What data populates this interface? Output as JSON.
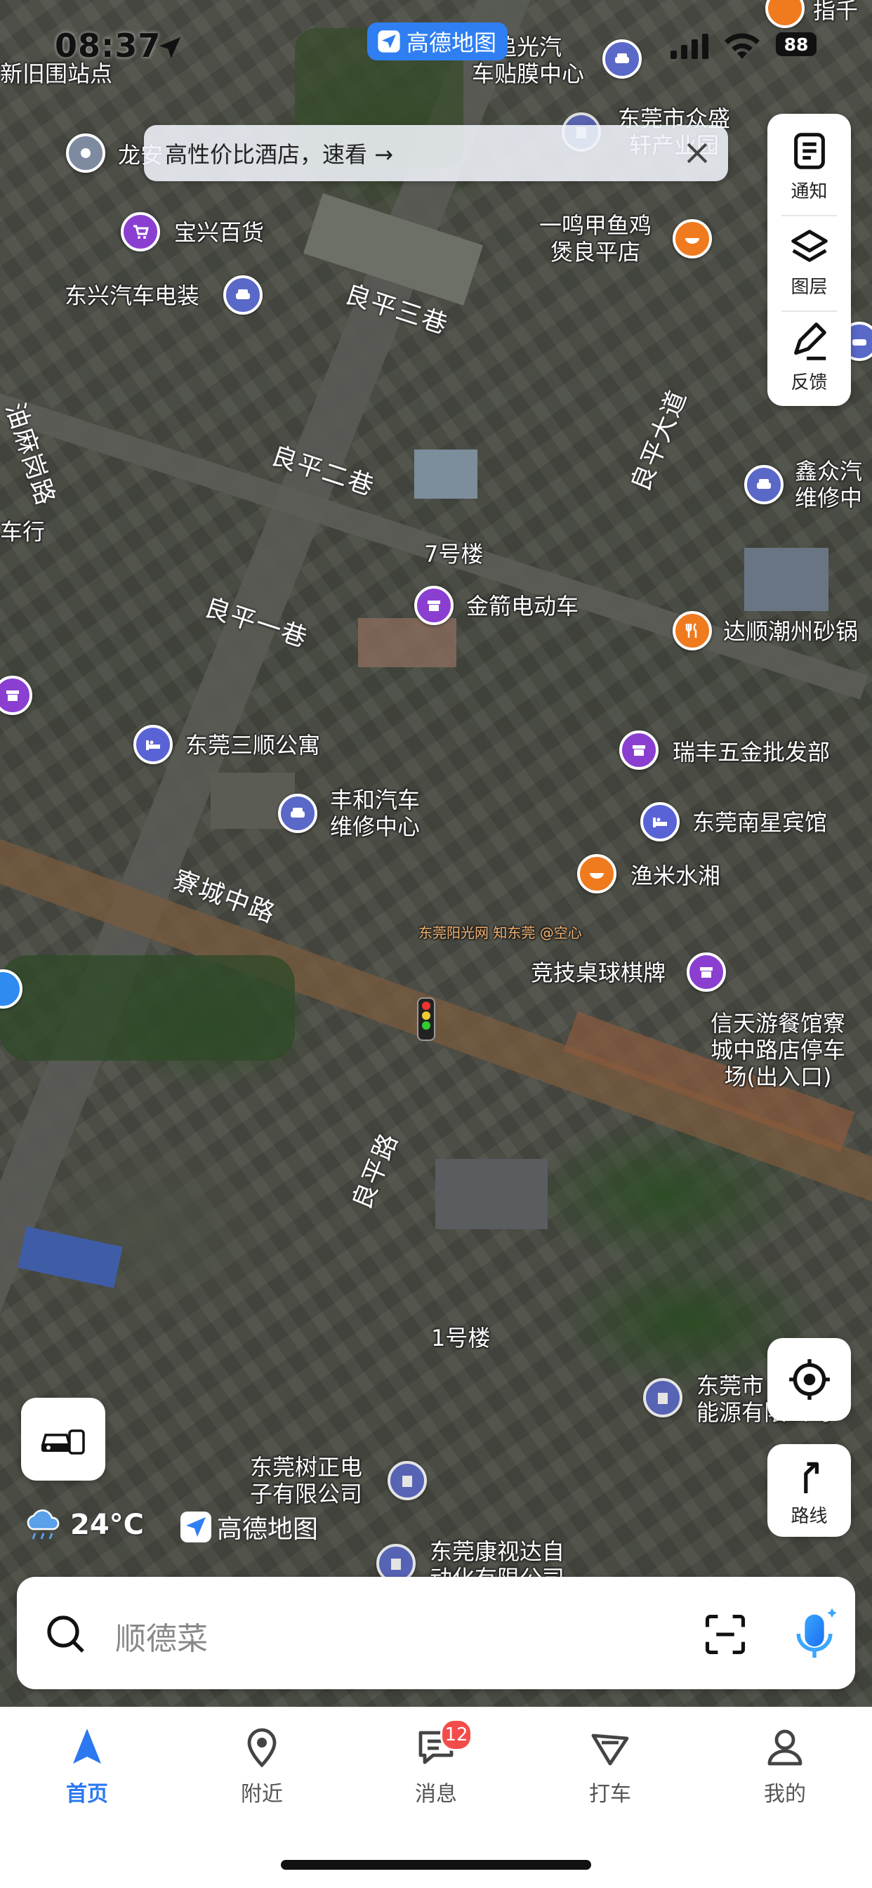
{
  "status_bar": {
    "time": "08:37",
    "battery": "88",
    "app_pill": "高德地图"
  },
  "banner": {
    "text": "高性价比酒店，速看 →"
  },
  "tools": [
    {
      "label": "通知",
      "icon": "notification-icon"
    },
    {
      "label": "图层",
      "icon": "layers-icon"
    },
    {
      "label": "反馈",
      "icon": "feedback-icon"
    }
  ],
  "map": {
    "roads": {
      "lp3": "良平三巷",
      "lp2": "良平二巷",
      "lp1": "良平一巷",
      "lpdd": "良平大道",
      "yml": "油麻岗路",
      "zczl": "寮城中路",
      "lpl": "良平路"
    },
    "pois": {
      "xinweizhan": "新旧围站点",
      "longan": "龙安",
      "zhuiguang": "追光汽\n车贴膜中心",
      "zhongsheng": "东莞市众盛\n轩产业园",
      "baoxing": "宝兴百货",
      "dongxing": "东兴汽车电装",
      "yimingjia": "一鸣甲鱼鸡\n煲良平店",
      "xinzhong": "鑫众汽\n维修中心",
      "cheheng": "车行",
      "lou7": "7号楼",
      "jinjian": "金箭电动车",
      "dashun": "达顺潮州砂锅",
      "sanshun": "东莞三顺公寓",
      "ruifeng": "瑞丰五金批发部",
      "fenghe": "丰和汽车\n维修中心",
      "nanxing": "东莞南星宾馆",
      "yumi": "渔米水湘",
      "jingji": "竞技桌球棋牌",
      "xintian": "信天游餐馆寮\n城中路店停车\n场(出入口)",
      "lou1": "1号楼",
      "shuzheng": "东莞树正电\n子有限公司",
      "nengyuan": "东莞市\n能源有限公司",
      "kangshida": "东莞康视达自\n动化有限公司"
    },
    "watermark": "东莞阳光网  知东莞  @空心"
  },
  "weather": {
    "temp": "24°C",
    "icon": "rain-cloud-icon"
  },
  "brand_logo": "高德地图",
  "buttons": {
    "locate_icon": "locate-icon",
    "route_label": "路线"
  },
  "search": {
    "placeholder": "顺德菜"
  },
  "nav": [
    {
      "label": "首页",
      "icon": "home-arrow-icon",
      "active": true
    },
    {
      "label": "附近",
      "icon": "location-pin-icon"
    },
    {
      "label": "消息",
      "icon": "message-icon",
      "badge": "12"
    },
    {
      "label": "打车",
      "icon": "taxi-icon"
    },
    {
      "label": "我的",
      "icon": "user-icon"
    }
  ],
  "colors": {
    "accent": "#2b78f0",
    "poi_purple": "#8b3fd0",
    "poi_orange": "#f07a1e",
    "poi_blue": "#5a63d6",
    "badge": "#f44b4b"
  }
}
